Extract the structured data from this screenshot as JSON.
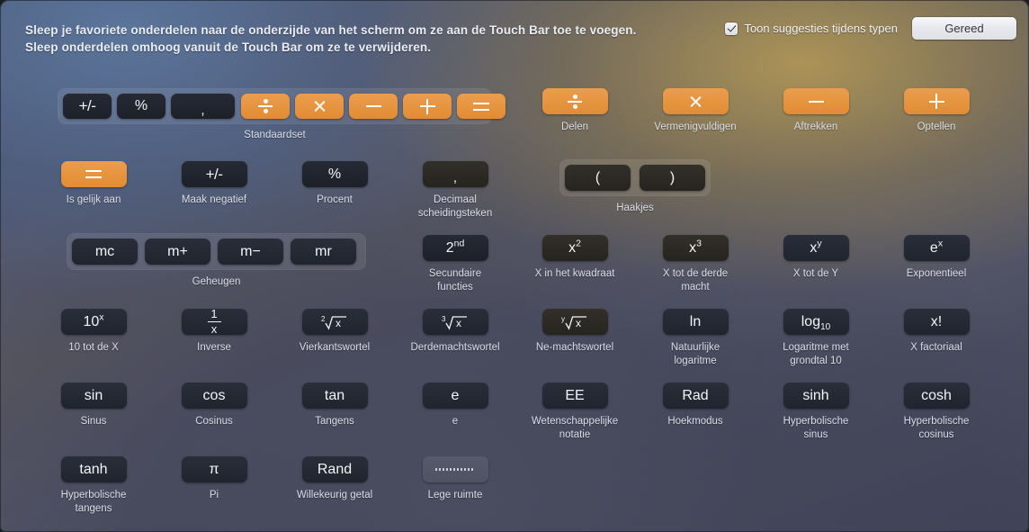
{
  "header": {
    "instruction_line1": "Sleep je favoriete onderdelen naar de onderzijde van het scherm om ze aan de Touch Bar toe te voegen.",
    "instruction_line2": "Sleep onderdelen omhoog vanuit de Touch Bar om ze te verwijderen.",
    "checkbox_label": "Toon suggesties tijdens typen",
    "checkbox_checked": "true",
    "done_label": "Gereed"
  },
  "colors": {
    "accent_orange": "#e8943e",
    "button_dark": "#222630",
    "empty_button": "#535767",
    "text": "#e9edf3"
  },
  "groups": {
    "standardset": {
      "caption": "Standaardset",
      "buttons": [
        {
          "glyph": "+/-",
          "style": "dark",
          "name": "plus-minus"
        },
        {
          "glyph": "%",
          "style": "dark",
          "name": "percent"
        },
        {
          "glyph": ",",
          "style": "dark",
          "name": "decimal-separator"
        },
        {
          "glyph": "÷",
          "style": "orange",
          "name": "divide"
        },
        {
          "glyph": "×",
          "style": "orange",
          "name": "multiply"
        },
        {
          "glyph": "−",
          "style": "orange",
          "name": "subtract"
        },
        {
          "glyph": "+",
          "style": "orange",
          "name": "add"
        },
        {
          "glyph": "=",
          "style": "orange",
          "name": "equals"
        }
      ]
    },
    "parentheses": {
      "caption": "Haakjes",
      "buttons": [
        {
          "glyph": "(",
          "name": "open-paren"
        },
        {
          "glyph": ")",
          "name": "close-paren"
        }
      ]
    },
    "memory": {
      "caption": "Geheugen",
      "buttons": [
        {
          "glyph": "mc",
          "name": "memory-clear"
        },
        {
          "glyph": "m+",
          "name": "memory-add"
        },
        {
          "glyph": "m−",
          "name": "memory-subtract"
        },
        {
          "glyph": "mr",
          "name": "memory-recall"
        }
      ]
    }
  },
  "items": {
    "divide": {
      "caption": "Delen"
    },
    "multiply": {
      "caption": "Vermenigvuldigen"
    },
    "subtract": {
      "caption": "Aftrekken"
    },
    "add": {
      "caption": "Optellen"
    },
    "equals": {
      "caption": "Is gelijk aan"
    },
    "negate": {
      "caption": "Maak negatief"
    },
    "percent": {
      "caption": "Procent"
    },
    "decimal": {
      "caption": "Decimaal scheidingsteken"
    },
    "second": {
      "caption": "Secundaire functies",
      "glyph": "2nd"
    },
    "square": {
      "caption": "X in het kwadraat",
      "glyph": "x2"
    },
    "cube": {
      "caption": "X tot de derde macht",
      "glyph": "x3"
    },
    "xpowy": {
      "caption": "X tot de Y",
      "glyph": "xy"
    },
    "exponential": {
      "caption": "Exponentieel",
      "glyph": "e^x"
    },
    "tenpowx": {
      "caption": "10 tot de X",
      "glyph": "10x"
    },
    "inverse": {
      "caption": "Inverse",
      "glyph": "1/x"
    },
    "sqrt": {
      "caption": "Vierkantswortel",
      "glyph": "2√x"
    },
    "cbrt": {
      "caption": "Derdemachtswortel",
      "glyph": "3√x"
    },
    "nthroot": {
      "caption": "Ne-machtswortel",
      "glyph": "y√x"
    },
    "ln": {
      "caption": "Natuurlijke logaritme",
      "glyph": "ln"
    },
    "log10": {
      "caption": "Logaritme met grondtal 10",
      "glyph": "log10"
    },
    "factorial": {
      "caption": "X factoriaal",
      "glyph": "x!"
    },
    "sin": {
      "caption": "Sinus",
      "glyph": "sin"
    },
    "cos": {
      "caption": "Cosinus",
      "glyph": "cos"
    },
    "tan": {
      "caption": "Tangens",
      "glyph": "tan"
    },
    "e": {
      "caption": "e",
      "glyph": "e"
    },
    "ee": {
      "caption": "Wetenschappelijke notatie",
      "glyph": "EE"
    },
    "rad": {
      "caption": "Hoekmodus",
      "glyph": "Rad"
    },
    "sinh": {
      "caption": "Hyperbolische sinus",
      "glyph": "sinh"
    },
    "cosh": {
      "caption": "Hyperbolische cosinus",
      "glyph": "cosh"
    },
    "tanh": {
      "caption": "Hyperbolische tangens",
      "glyph": "tanh"
    },
    "pi": {
      "caption": "Pi",
      "glyph": "π"
    },
    "rand": {
      "caption": "Willekeurig getal",
      "glyph": "Rand"
    },
    "space": {
      "caption": "Lege ruimte",
      "glyph": "dots"
    }
  }
}
